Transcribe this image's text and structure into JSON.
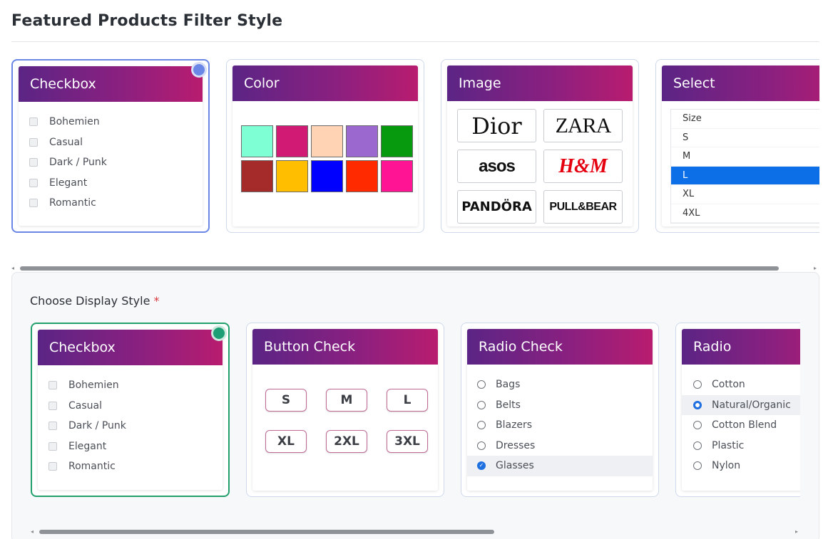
{
  "header": {
    "title": "Featured Products Filter Style"
  },
  "top_cards": [
    {
      "title": "Checkbox",
      "options": [
        "Bohemien",
        "Casual",
        "Dark / Punk",
        "Elegant",
        "Romantic"
      ]
    },
    {
      "title": "Color",
      "colors": [
        "#7fffd4",
        "#d01a73",
        "#ffd3b3",
        "#9b68cf",
        "#079a0e",
        "#a52a2a",
        "#ffbf00",
        "#0000ff",
        "#ff2a00",
        "#ff1493"
      ]
    },
    {
      "title": "Image",
      "brands": [
        "Dior",
        "ZARA",
        "asos",
        "H&M",
        "PANDÖRA",
        "PULL&BEAR"
      ]
    },
    {
      "title": "Select",
      "options": [
        "Size",
        "S",
        "M",
        "L",
        "XL",
        "4XL"
      ],
      "selected": "L"
    }
  ],
  "panel": {
    "label": "Choose Display Style",
    "required_mark": "*",
    "cards": [
      {
        "title": "Checkbox",
        "options": [
          "Bohemien",
          "Casual",
          "Dark / Punk",
          "Elegant",
          "Romantic"
        ]
      },
      {
        "title": "Button Check",
        "sizes": [
          "S",
          "M",
          "L",
          "XL",
          "2XL",
          "3XL"
        ]
      },
      {
        "title": "Radio Check",
        "options": [
          "Bags",
          "Belts",
          "Blazers",
          "Dresses",
          "Glasses"
        ],
        "checked": "Glasses"
      },
      {
        "title": "Radio",
        "options": [
          "Cotton",
          "Natural/Organic",
          "Cotton Blend",
          "Plastic",
          "Nylon"
        ],
        "selected": "Natural/Organic"
      }
    ]
  },
  "colors": {
    "selected_top": "#6a86e6",
    "selected_panel": "#22a06b",
    "header_gradient_start": "#5b2585",
    "header_gradient_end": "#b81c6f",
    "select_highlight": "#0d6fe8"
  }
}
